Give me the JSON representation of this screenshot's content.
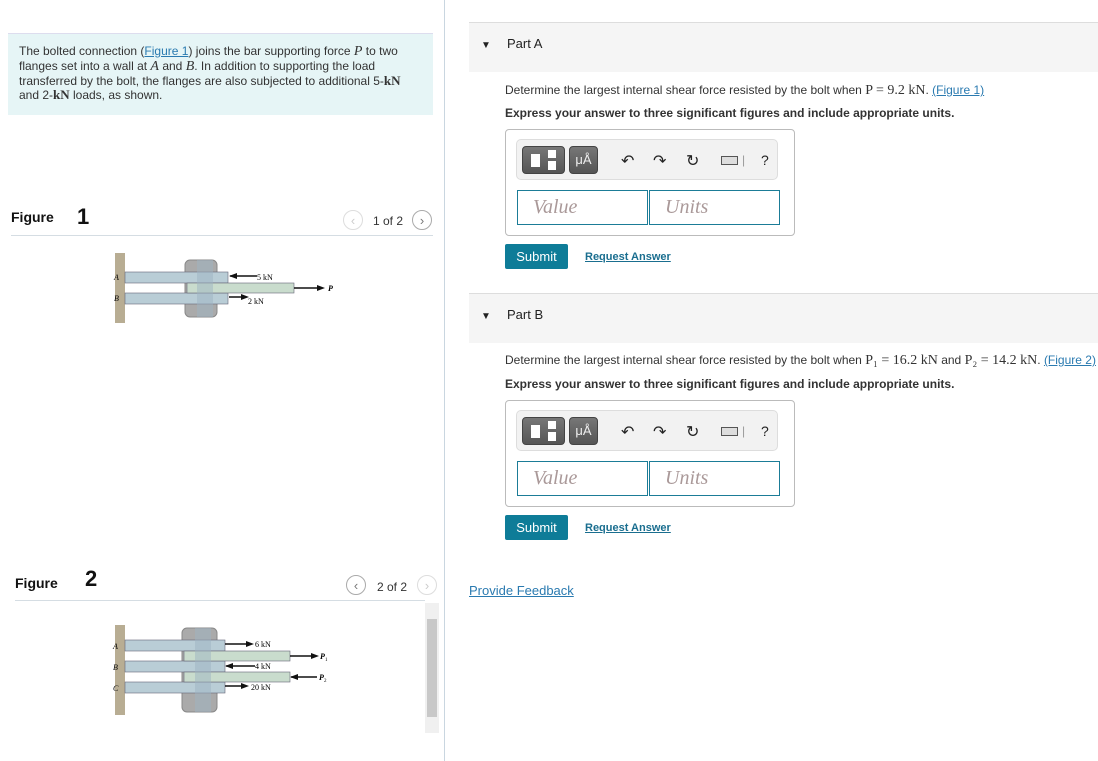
{
  "intro": {
    "t1": "The bolted connection (",
    "link": "Figure 1",
    "t2": ") joins the bar supporting force ",
    "P": "P",
    "t3": " to two flanges set into a wall at ",
    "A": "A",
    "t4": " and ",
    "B": "B",
    "t5": ". In addition to supporting the load transferred by the bolt, the flanges are also subjected to additional 5-",
    "kN1": "kN",
    "t6": " and 2-",
    "kN2": "kN",
    "t7": " loads, as shown."
  },
  "figures": [
    {
      "label": "Figure",
      "number": "1",
      "pager": "1 of 2",
      "labels": {
        "a": "A",
        "b": "B",
        "f1": "5 kN",
        "f2": "2 kN",
        "p": "P"
      }
    },
    {
      "label": "Figure",
      "number": "2",
      "pager": "2 of 2",
      "labels": {
        "a": "A",
        "b": "B",
        "c": "C",
        "f1": "6 kN",
        "f2": "4 kN",
        "f3": "20 kN",
        "p1": "P",
        "p1sub": "1",
        "p2": "P",
        "p2sub": "2"
      }
    }
  ],
  "nav": {
    "prev": "‹",
    "next": "›"
  },
  "partA": {
    "title": "Part A",
    "q1": "Determine the largest internal shear force resisted by the bolt when ",
    "math": "P = 9.2 kN",
    "q2": ". ",
    "link": "(Figure 1)",
    "instr": "Express your answer to three significant figures and include appropriate units.",
    "value_placeholder": "Value",
    "units_placeholder": "Units",
    "submit": "Submit",
    "request": "Request Answer"
  },
  "partB": {
    "title": "Part B",
    "q1": "Determine the largest internal shear force resisted by the bolt when ",
    "math1": "P₁ = 16.2 kN",
    "and": " and ",
    "math2": "P₂ = 14.2 kN",
    "q2": ". ",
    "link": "(Figure 2)",
    "instr": "Express your answer to three significant figures and include appropriate units.",
    "value_placeholder": "Value",
    "units_placeholder": "Units",
    "submit": "Submit",
    "request": "Request Answer"
  },
  "toolbar": {
    "templates_icon": "templates-icon",
    "units_label": "μÅ",
    "undo": "↶",
    "redo": "↷",
    "reset": "↻",
    "keyboard_icon": "keyboard-icon",
    "sep": "|",
    "help": "?"
  },
  "feedback": "Provide Feedback"
}
